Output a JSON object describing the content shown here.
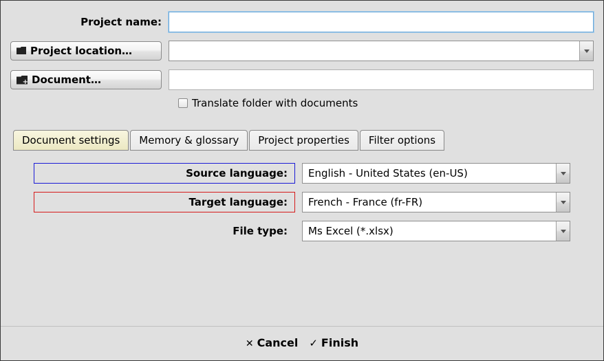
{
  "labels": {
    "project_name": "Project name:",
    "project_location_btn": "Project location…",
    "document_btn": "Document…",
    "translate_folder": "Translate folder with documents"
  },
  "fields": {
    "project_name": "",
    "project_location": "",
    "document": ""
  },
  "tabs": [
    {
      "label": "Document settings",
      "active": true
    },
    {
      "label": "Memory & glossary",
      "active": false
    },
    {
      "label": "Project properties",
      "active": false
    },
    {
      "label": "Filter options",
      "active": false
    }
  ],
  "settings": {
    "source_language_label": "Source language:",
    "source_language_value": "English - United States (en-US)",
    "target_language_label": "Target language:",
    "target_language_value": "French - France (fr-FR)",
    "file_type_label": "File type:",
    "file_type_value": "Ms Excel (*.xlsx)"
  },
  "footer": {
    "cancel": "Cancel",
    "finish": "Finish"
  }
}
